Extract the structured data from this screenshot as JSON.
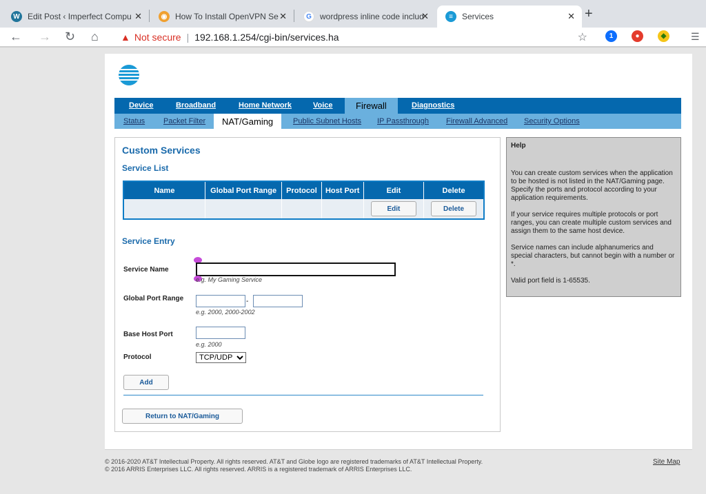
{
  "browser": {
    "tabs": [
      {
        "title": "Edit Post ‹ Imperfect Computing",
        "icon": "wordpress-icon"
      },
      {
        "title": "How To Install OpenVPN Server o",
        "icon": "openvpn-icon"
      },
      {
        "title": "wordpress inline code include co",
        "icon": "google-icon"
      },
      {
        "title": "Services",
        "icon": "att-icon"
      }
    ],
    "security_label": "Not secure",
    "url": "192.168.1.254/cgi-bin/services.ha"
  },
  "nav": {
    "main": [
      "Device",
      "Broadband",
      "Home Network",
      "Voice",
      "Firewall",
      "Diagnostics"
    ],
    "active_main": "Firewall",
    "sub": [
      "Status",
      "Packet Filter",
      "NAT/Gaming",
      "Public Subnet Hosts",
      "IP Passthrough",
      "Firewall Advanced",
      "Security Options"
    ],
    "active_sub": "NAT/Gaming"
  },
  "custom_services": {
    "title": "Custom Services",
    "list_title": "Service List",
    "columns": [
      "Name",
      "Global Port Range",
      "Protocol",
      "Host Port",
      "Edit",
      "Delete"
    ],
    "row": {
      "name": "",
      "port_range": "",
      "protocol": "",
      "host_port": "",
      "edit_label": "Edit",
      "delete_label": "Delete"
    }
  },
  "service_entry": {
    "title": "Service Entry",
    "name_label": "Service Name",
    "name_hint": "e.g. My Gaming Service",
    "name_value": "",
    "port_range_label": "Global Port Range",
    "port_range_dash": "-",
    "port_range_hint": "e.g. 2000, 2000-2002",
    "host_port_label": "Base Host Port",
    "host_port_hint": "e.g. 2000",
    "protocol_label": "Protocol",
    "protocol_value": "TCP/UDP",
    "add_label": "Add",
    "return_label": "Return to NAT/Gaming"
  },
  "help": {
    "title": "Help",
    "paragraphs": [
      "You can create custom services when the application to be hosted is not listed in the NAT/Gaming page. Specify the ports and protocol according to your application requirements.",
      "If your service requires multiple protocols or port ranges, you can create multiple custom services and assign them to the same host device.",
      "Service names can include alphanumerics and special characters, but cannot begin with a number or *.",
      "Valid port field is 1-65535."
    ]
  },
  "footer": {
    "line1": "© 2016-2020 AT&T Intellectual Property. All rights reserved. AT&T and Globe logo are registered trademarks of AT&T Intellectual Property.",
    "line2": "© 2016 ARRIS Enterprises LLC. All rights reserved. ARRIS is a registered trademark of ARRIS Enterprises LLC.",
    "site_map": "Site Map"
  },
  "colors": {
    "att_blue": "#0568ae",
    "att_light_blue": "#6ab0de",
    "heading_blue": "#1a6aab"
  }
}
